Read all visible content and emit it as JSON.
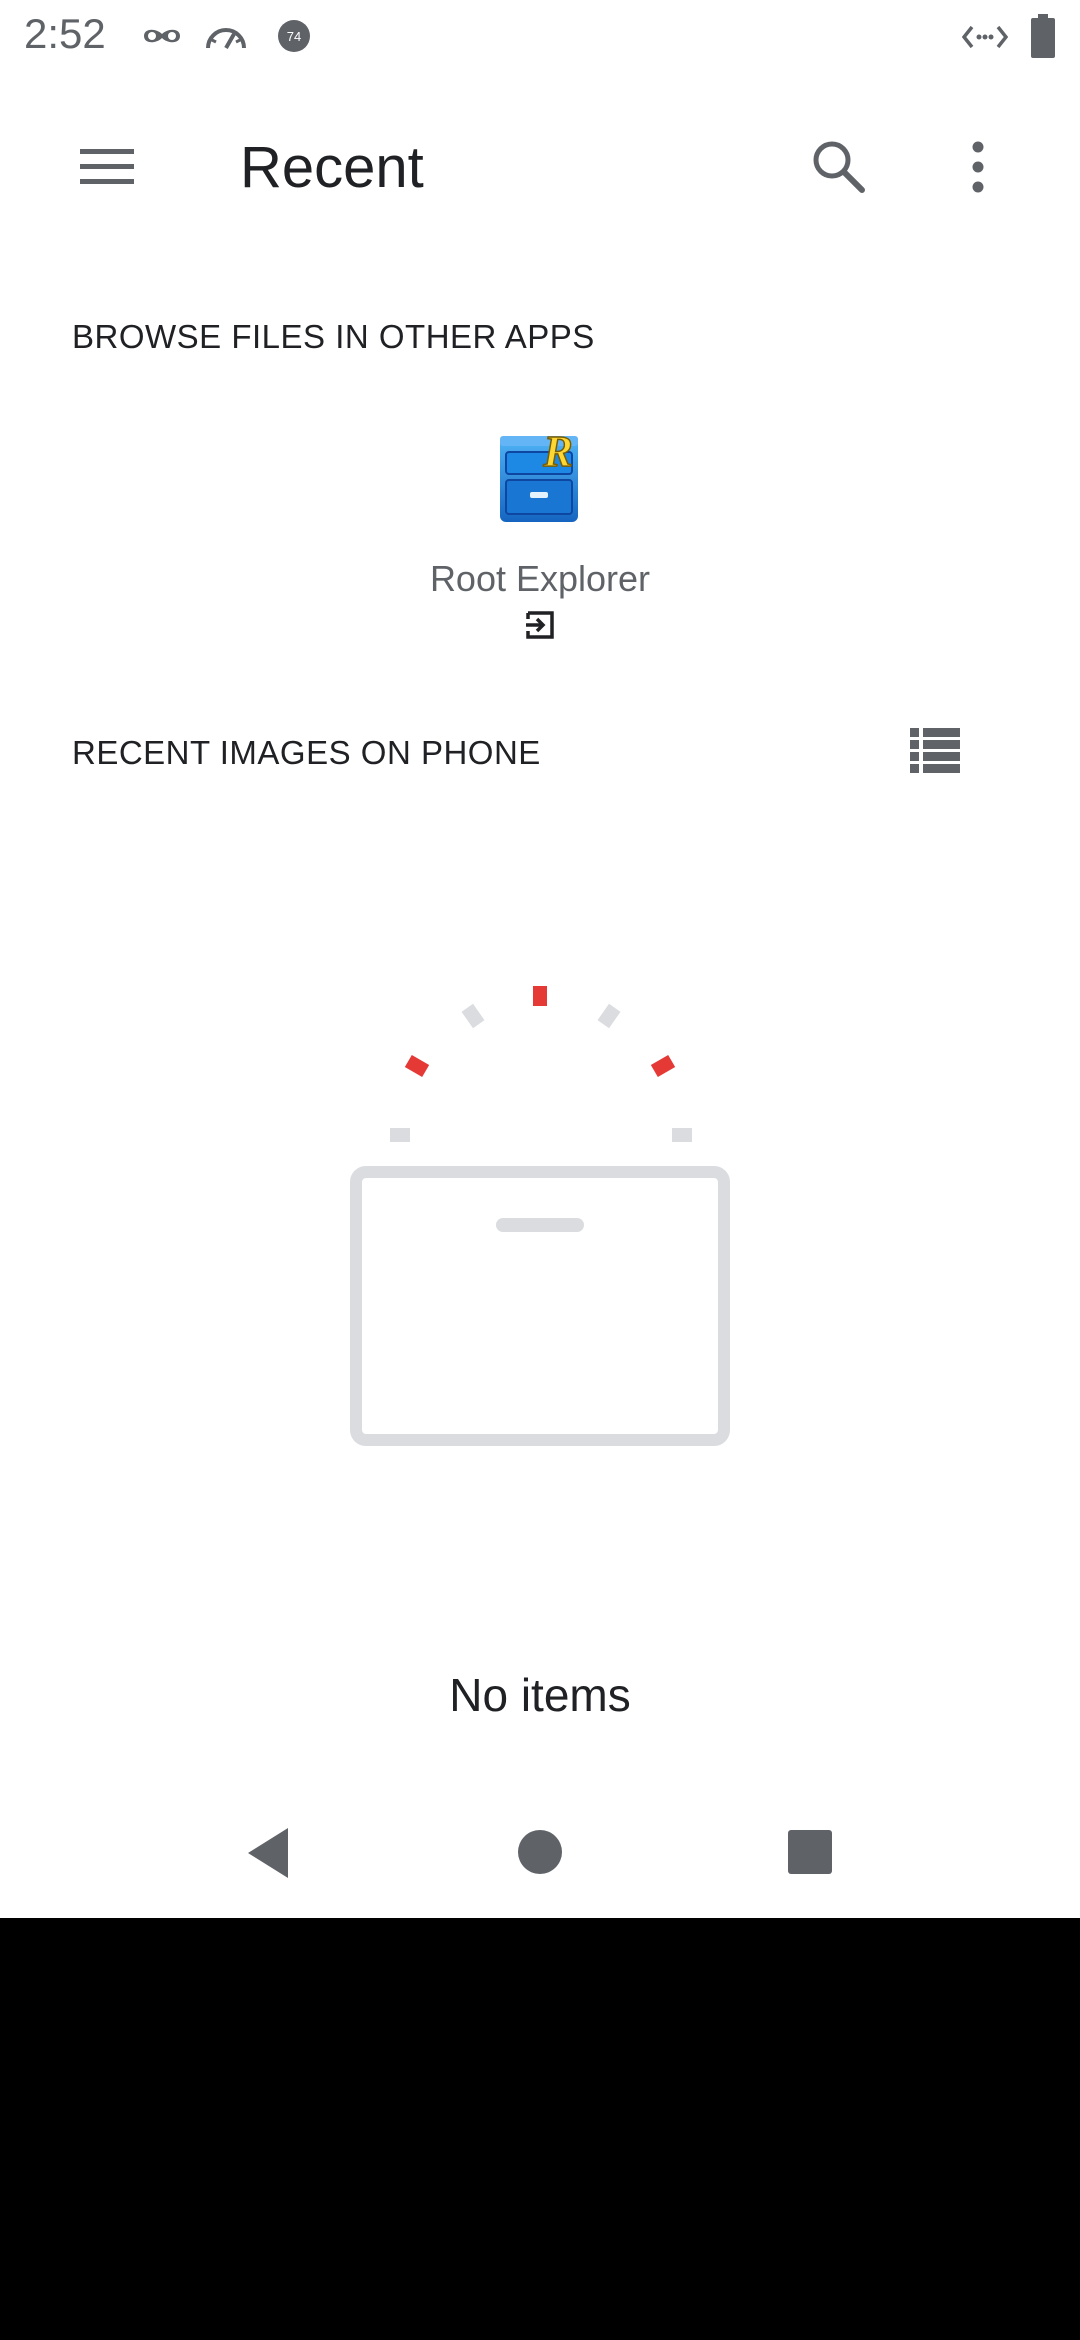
{
  "status_bar": {
    "time": "2:52",
    "icons": [
      "incognito-icon",
      "speedometer-icon",
      "notification-badge-icon",
      "data-arrows-icon",
      "battery-icon"
    ],
    "badge_number": "74"
  },
  "app_bar": {
    "title": "Recent",
    "menu_icon": "hamburger-menu-icon",
    "search_icon": "search-icon",
    "more_icon": "more-vert-icon"
  },
  "browse_section": {
    "header": "BROWSE FILES IN OTHER APPS",
    "apps": [
      {
        "label": "Root Explorer",
        "icon": "root-explorer-app-icon",
        "action_icon": "open-in-app-icon"
      }
    ]
  },
  "images_section": {
    "header": "RECENT IMAGES ON PHONE",
    "view_toggle_icon": "list-view-icon"
  },
  "empty_state": {
    "text": "No items",
    "illustration": "empty-box-illustration"
  },
  "nav_bar": {
    "back": "back-triangle-icon",
    "home": "home-circle-icon",
    "recents": "recents-square-icon"
  },
  "colors": {
    "accent_red": "#e53935",
    "icon_grey": "#5f6368",
    "illustration_grey": "#dadce0",
    "background": "#ffffff",
    "below_screen": "#000000"
  }
}
